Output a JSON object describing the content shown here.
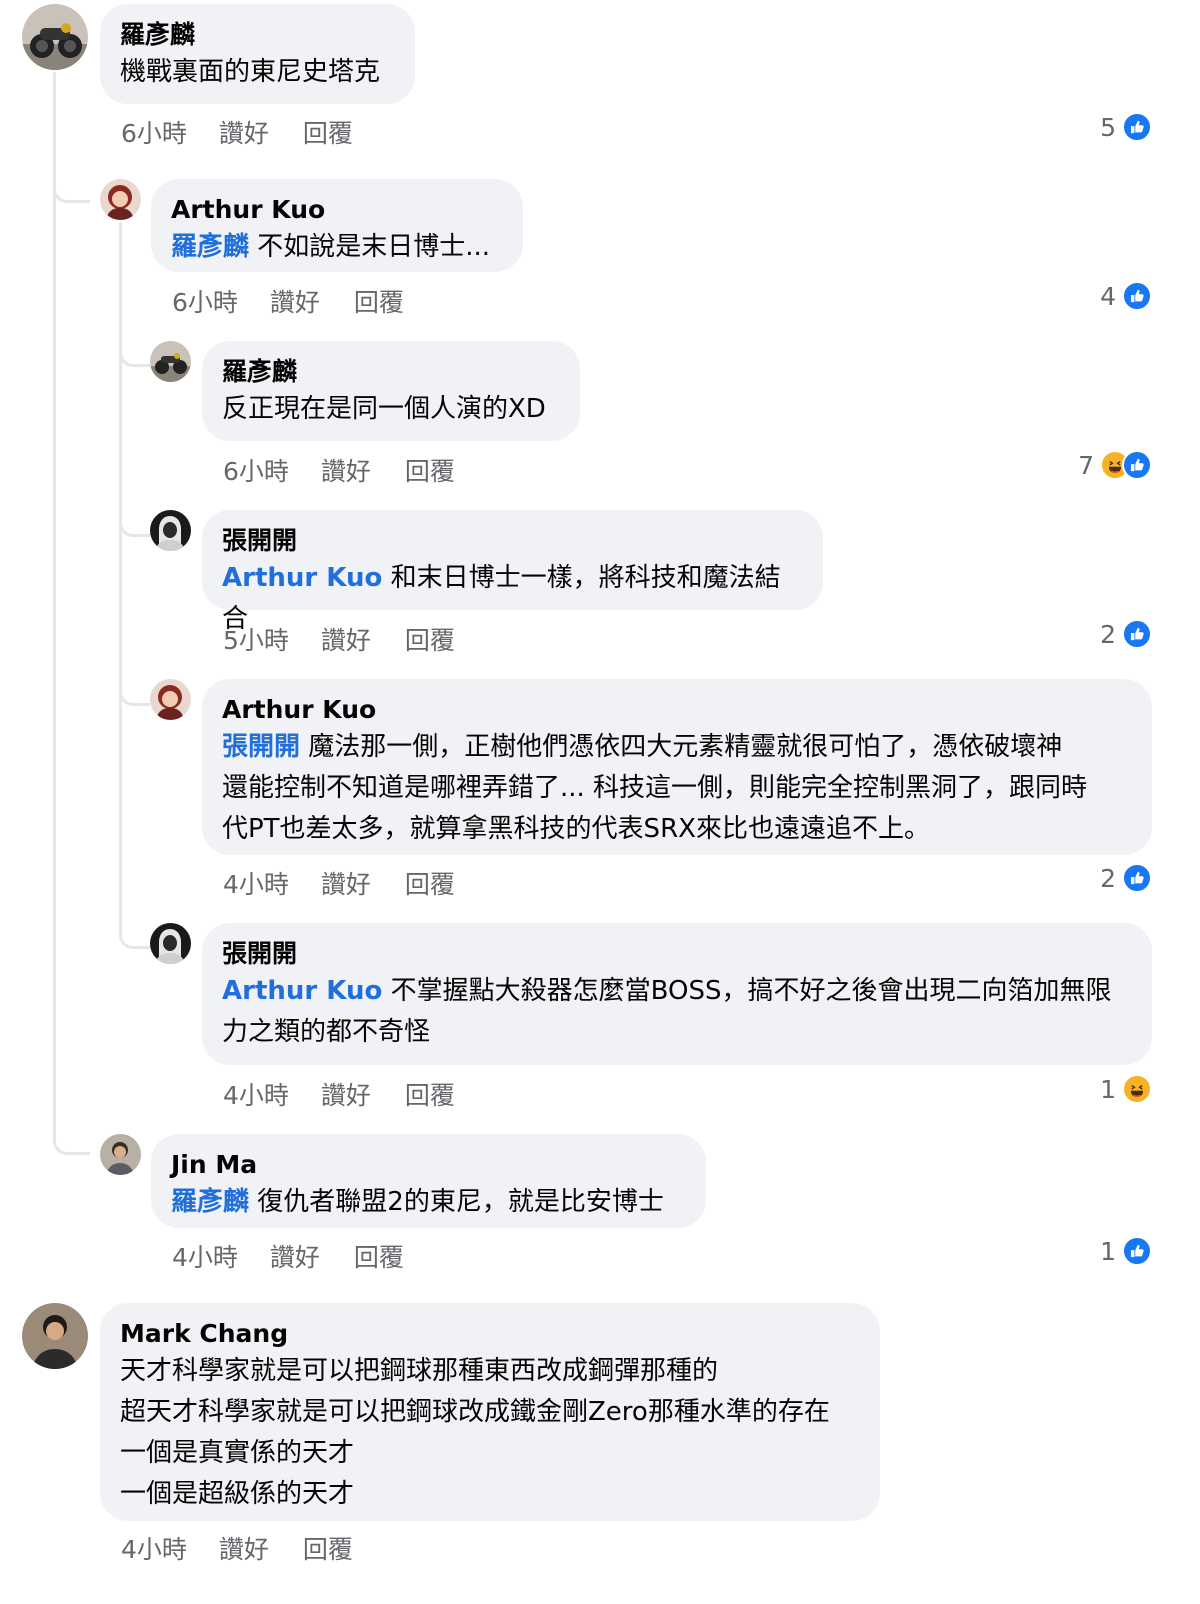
{
  "comments": [
    {
      "author": "羅彥麟",
      "mention": "",
      "text": "機戰裏面的東尼史塔克",
      "time": "6小時",
      "like": "讚好",
      "reply": "回覆",
      "reaction_count": "5",
      "reactions": [
        "like"
      ]
    },
    {
      "author": "Arthur Kuo",
      "mention": "羅彥麟",
      "text": " 不如說是末日博士...",
      "time": "6小時",
      "like": "讚好",
      "reply": "回覆",
      "reaction_count": "4",
      "reactions": [
        "like"
      ]
    },
    {
      "author": "羅彥麟",
      "mention": "",
      "text": "反正現在是同一個人演的XD",
      "time": "6小時",
      "like": "讚好",
      "reply": "回覆",
      "reaction_count": "7",
      "reactions": [
        "haha",
        "like"
      ]
    },
    {
      "author": "張開開",
      "mention": "Arthur Kuo",
      "text": " 和末日博士一樣，將科技和魔法結合",
      "time": "5小時",
      "like": "讚好",
      "reply": "回覆",
      "reaction_count": "2",
      "reactions": [
        "like"
      ]
    },
    {
      "author": "Arthur Kuo",
      "mention": "張開開",
      "text_lines": [
        " 魔法那一側，正樹他們憑依四大元素精靈就很可怕了，憑依破壞神",
        "還能控制不知道是哪裡弄錯了... 科技這一側，則能完全控制黑洞了，跟同時",
        "代PT也差太多，就算拿黑科技的代表SRX來比也遠遠追不上。"
      ],
      "time": "4小時",
      "like": "讚好",
      "reply": "回覆",
      "reaction_count": "2",
      "reactions": [
        "like"
      ]
    },
    {
      "author": "張開開",
      "mention": "Arthur Kuo",
      "text_lines": [
        " 不掌握點大殺器怎麼當BOSS，搞不好之後會出現二向箔加無限",
        "力之類的都不奇怪"
      ],
      "time": "4小時",
      "like": "讚好",
      "reply": "回覆",
      "reaction_count": "1",
      "reactions": [
        "haha"
      ]
    },
    {
      "author": "Jin Ma",
      "mention": "羅彥麟",
      "text": " 復仇者聯盟2的東尼，就是比安博士",
      "time": "4小時",
      "like": "讚好",
      "reply": "回覆",
      "reaction_count": "1",
      "reactions": [
        "like"
      ]
    },
    {
      "author": "Mark Chang",
      "mention": "",
      "text_lines": [
        "天才科學家就是可以把鋼球那種東西改成鋼彈那種的",
        "超天才科學家就是可以把鋼球改成鐵金剛Zero那種水準的存在",
        "一個是真實係的天才",
        "一個是超級係的天才"
      ],
      "time": "4小時",
      "like": "讚好",
      "reply": "回覆"
    }
  ],
  "colors": {
    "mention": "#216fdb",
    "bubble": "#f0f2f5",
    "meta": "#65676b",
    "like": "#1877f2",
    "haha": "#f7b125"
  }
}
